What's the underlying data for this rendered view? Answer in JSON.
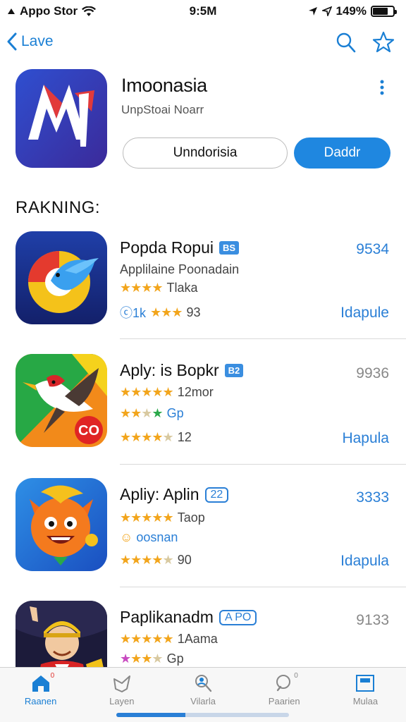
{
  "status": {
    "carrier": "Appo Stor",
    "time": "9:5M",
    "battery": "149%"
  },
  "nav": {
    "back_label": "Lave"
  },
  "featured": {
    "title": "Imoonasia",
    "subtitle": "UnpStoai Noarr",
    "secondary_button": "Unndorisia",
    "primary_button": "Daddr"
  },
  "section_title": "RAKNING:",
  "ranking": [
    {
      "title": "Popda Ropui",
      "badge": "BS",
      "line1": "Applilaine Poonadain",
      "line2_text": "Tlaka",
      "line3_prefix": "ⓒ1k",
      "line3_text": "93",
      "score": "9534",
      "action": "Idapule"
    },
    {
      "title": "Aply: is Bopkr",
      "badge": "B2",
      "line1_text": "12mor",
      "line2_text": "Gp",
      "line3_text": "12",
      "score": "9936",
      "action": "Hapula",
      "icon_text": "CO"
    },
    {
      "title": "Apliy: Aplin",
      "badge": "22",
      "line1_text": "Taop",
      "line2_text": "oosnan",
      "line3_text": "90",
      "score": "3333",
      "action": "Idapula"
    },
    {
      "title": "Paplikanadm",
      "badge": "A PO",
      "line1_text": "1Aama",
      "line2_text": "Gp",
      "score": "9133"
    }
  ],
  "tabs": [
    {
      "label": "Raanen",
      "icon": "home-icon",
      "badge": "0"
    },
    {
      "label": "Layen",
      "icon": "layers-icon"
    },
    {
      "label": "Vilarla",
      "icon": "search-people-icon"
    },
    {
      "label": "Paarien",
      "icon": "search-icon",
      "badge": "0"
    },
    {
      "label": "Mulaa",
      "icon": "box-icon"
    }
  ],
  "colors": {
    "accent": "#1f87e0",
    "star": "#f2a51c"
  }
}
